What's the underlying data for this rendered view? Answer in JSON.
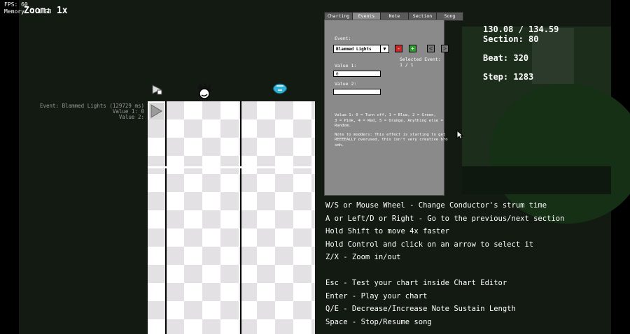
{
  "debug": {
    "fps": "FPS: 60",
    "memory": "Memory: 2.1 GB"
  },
  "zoom": "Zoom: 1x",
  "event_info": {
    "event": "Event: Blammed Lights (129729 ms)",
    "value1": "Value 1: 0",
    "value2": "Value 2:"
  },
  "tabs": [
    "Charting",
    "Events",
    "Note",
    "Section",
    "Song"
  ],
  "panel": {
    "event_label": "Event:",
    "event_value": "Blammed Lights",
    "remove_label": "-",
    "add_label": "+",
    "prev_label": "<",
    "next_label": ">",
    "selected_event": "Selected Event: 1 / 1",
    "value1_label": "Value 1:",
    "value1": "0",
    "value2_label": "Value 2:",
    "value2": "",
    "description": [
      "Value 1: 0 = Turn off, 1 = Blue, 2 = Green,",
      "3 = Pink, 4 = Red, 5 = Orange, Anything else = Random.",
      "",
      "Note to modders: This effect is starting to get",
      "REEEEALLY overused, this isn't very creative bro smh."
    ]
  },
  "stats": {
    "time": "130.08 / 134.59",
    "section": "Section: 80",
    "beat": "Beat: 320",
    "step": "Step: 1283"
  },
  "help": [
    "W/S or Mouse Wheel - Change Conductor's strum time",
    "A or Left/D or Right - Go to the previous/next section",
    "Hold Shift to move 4x faster",
    "Hold Control and click on an arrow to select it",
    "Z/X - Zoom in/out",
    "",
    "Esc - Test your chart inside Chart Editor",
    "Enter - Play your chart",
    "Q/E - Decrease/Increase Note Sustain Length",
    "Space - Stop/Resume song"
  ],
  "colors": {
    "remove": "#c62828",
    "add": "#2e9d2e",
    "panel": "#8a8a8a"
  }
}
